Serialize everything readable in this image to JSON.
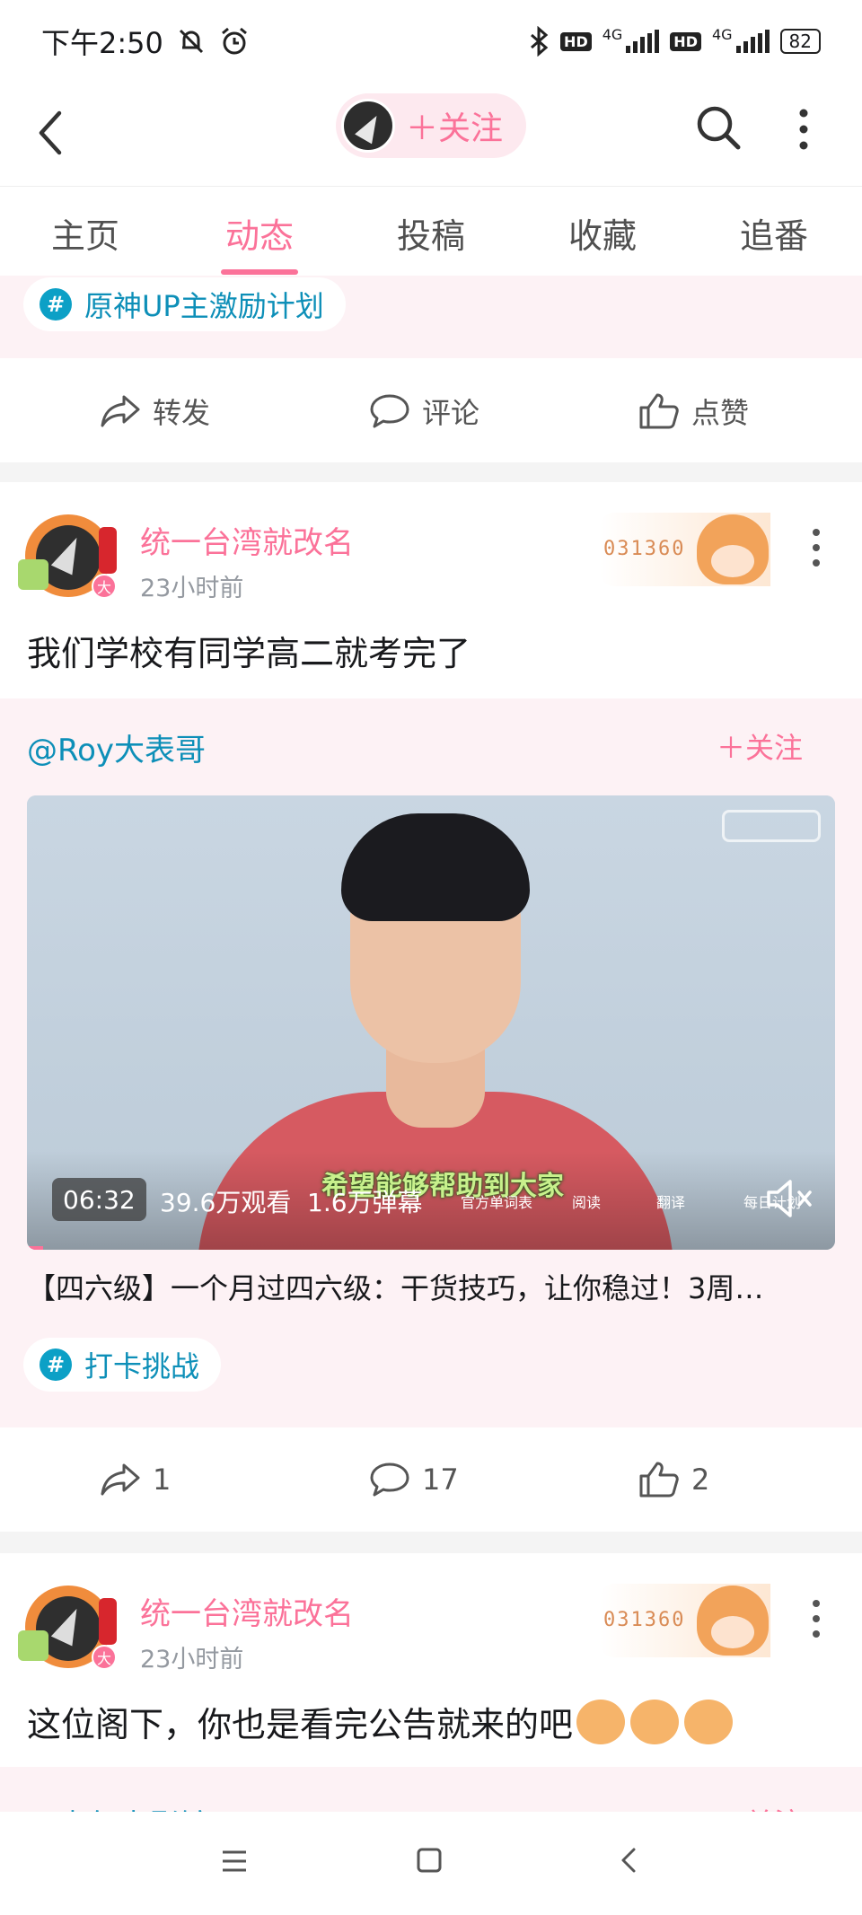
{
  "status_bar": {
    "time": "下午2:50",
    "network_1": "4G",
    "network_2": "4G",
    "hd_label": "HD",
    "battery": "82"
  },
  "nav": {
    "follow_label": "＋关注"
  },
  "tabs": [
    "主页",
    "动态",
    "投稿",
    "收藏",
    "追番"
  ],
  "active_tab": "动态",
  "post_top": {
    "topic": "原神UP主激励计划",
    "actions": {
      "share": "转发",
      "comment": "评论",
      "like": "点赞"
    }
  },
  "post_1": {
    "username": "统一台湾就改名",
    "time": "23小时前",
    "fan_badge_number": "031360",
    "level_badge": "大",
    "text": "我们学校有同学高二就考完了",
    "repost": {
      "author": "@Roy大表哥",
      "follow_label": "＋关注",
      "video": {
        "duration": "06:32",
        "views": "39.6万观看",
        "danmaku": "1.6万弹幕",
        "subtitle": "希望能够帮助到大家",
        "overlay_labels": [
          "官方单词表",
          "阅读",
          "翻译",
          "每日计划"
        ],
        "progress": 0.02
      },
      "title": "【四六级】一个月过四六级：干货技巧，让你稳过！3周…"
    },
    "topic": "打卡挑战",
    "actions": {
      "share": "1",
      "comment": "17",
      "like": "2"
    }
  },
  "post_2": {
    "username": "统一台湾就改名",
    "time": "23小时前",
    "fan_badge_number": "031360",
    "level_badge": "大",
    "text": "这位阁下，你也是看完公告就来的吧",
    "repost_author": "@青年电影馆",
    "follow_label": "＋关注"
  },
  "icons": {
    "back": "chevron-left-icon",
    "search": "search-icon",
    "more": "more-vertical-icon",
    "share": "share-arrow-icon",
    "comment": "comment-bubble-icon",
    "like": "thumbs-up-icon",
    "mute": "volume-mute-icon"
  },
  "colors": {
    "accent": "#fb7299",
    "topic": "#0d8fb8",
    "pink_bg": "#fdf2f5"
  }
}
